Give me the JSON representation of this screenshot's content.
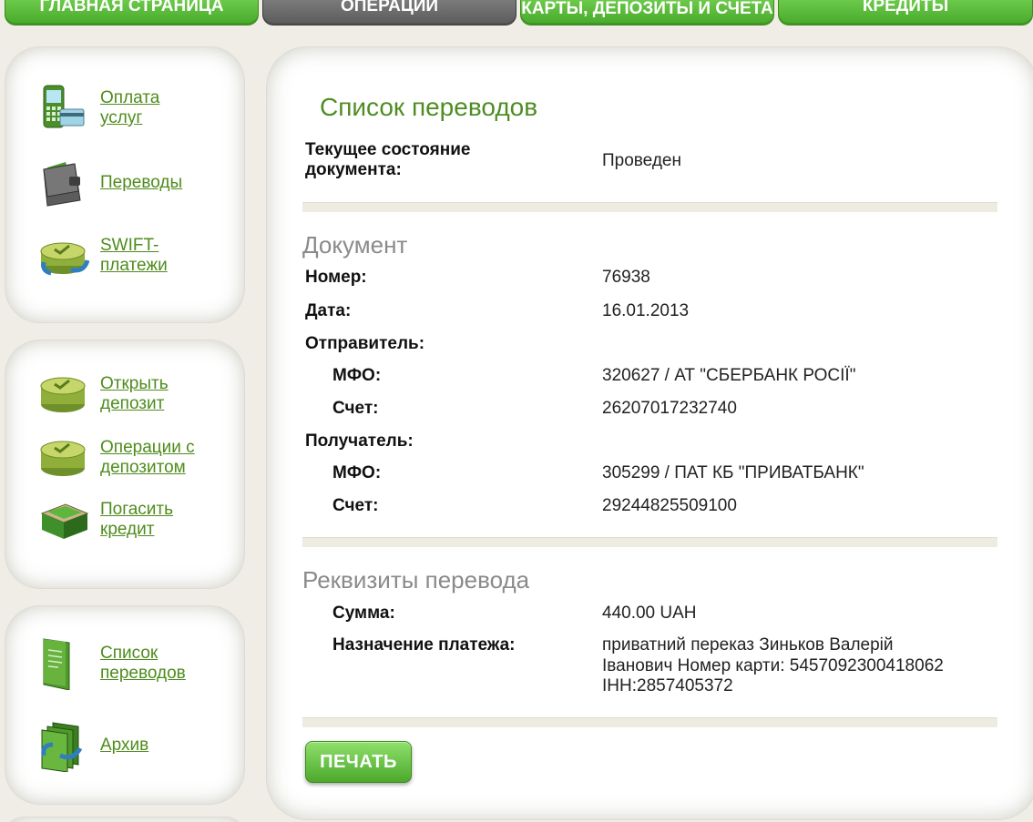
{
  "nav": {
    "tabs": [
      {
        "label": "Главная страница",
        "active": false
      },
      {
        "label": "Операции",
        "active": true
      },
      {
        "label": "Карты, депозиты и счета",
        "active": false
      },
      {
        "label": "Кредиты",
        "active": false
      }
    ]
  },
  "sidebar": {
    "group1": [
      {
        "label": "Оплата услуг",
        "icon": "mobile-phone-icon"
      },
      {
        "label": "Переводы",
        "icon": "wallet-icon"
      },
      {
        "label": "SWIFT-платежи",
        "icon": "coin-stack-transfer-icon"
      }
    ],
    "group2": [
      {
        "label": "Открыть депозит",
        "icon": "coin-stack-icon"
      },
      {
        "label": "Операции с депозитом",
        "icon": "coin-stack-icon"
      },
      {
        "label": "Погасить кредит",
        "icon": "money-stack-icon"
      }
    ],
    "group3": [
      {
        "label": "Список переводов",
        "icon": "document-icon"
      },
      {
        "label": "Архив",
        "icon": "archive-icon"
      }
    ]
  },
  "main": {
    "title": "Список переводов",
    "status_label": "Текущее состояние документа:",
    "status_value": "Проведен",
    "document": {
      "section_title": "Документ",
      "number_label": "Номер:",
      "number_value": "76938",
      "date_label": "Дата:",
      "date_value": "16.01.2013",
      "sender_label": "Отправитель:",
      "sender_mfo_label": "МФО:",
      "sender_mfo_value": "320627 / АТ \"СБЕРБАНК РОСІЇ\"",
      "sender_account_label": "Счет:",
      "sender_account_value": "26207017232740",
      "receiver_label": "Получатель:",
      "receiver_mfo_label": "МФО:",
      "receiver_mfo_value": "305299 / ПАТ КБ \"ПРИВАТБАНК\"",
      "receiver_account_label": "Счет:",
      "receiver_account_value": "29244825509100"
    },
    "requisites": {
      "section_title": "Реквизиты перевода",
      "amount_label": "Сумма:",
      "amount_value": "440.00 UAH",
      "purpose_label": "Назначение платежа:",
      "purpose_line1": "приватний переказ Зиньков Валерій",
      "purpose_line2": "Іванович Номер карти: 5457092300418062",
      "purpose_line3": "ІНН:2857405372"
    },
    "print_label": "Печать"
  },
  "colors": {
    "accent_green": "#4f8d24",
    "tab_green": "#47a92a",
    "tab_active": "#5b5b5b",
    "background": "#efede6"
  }
}
